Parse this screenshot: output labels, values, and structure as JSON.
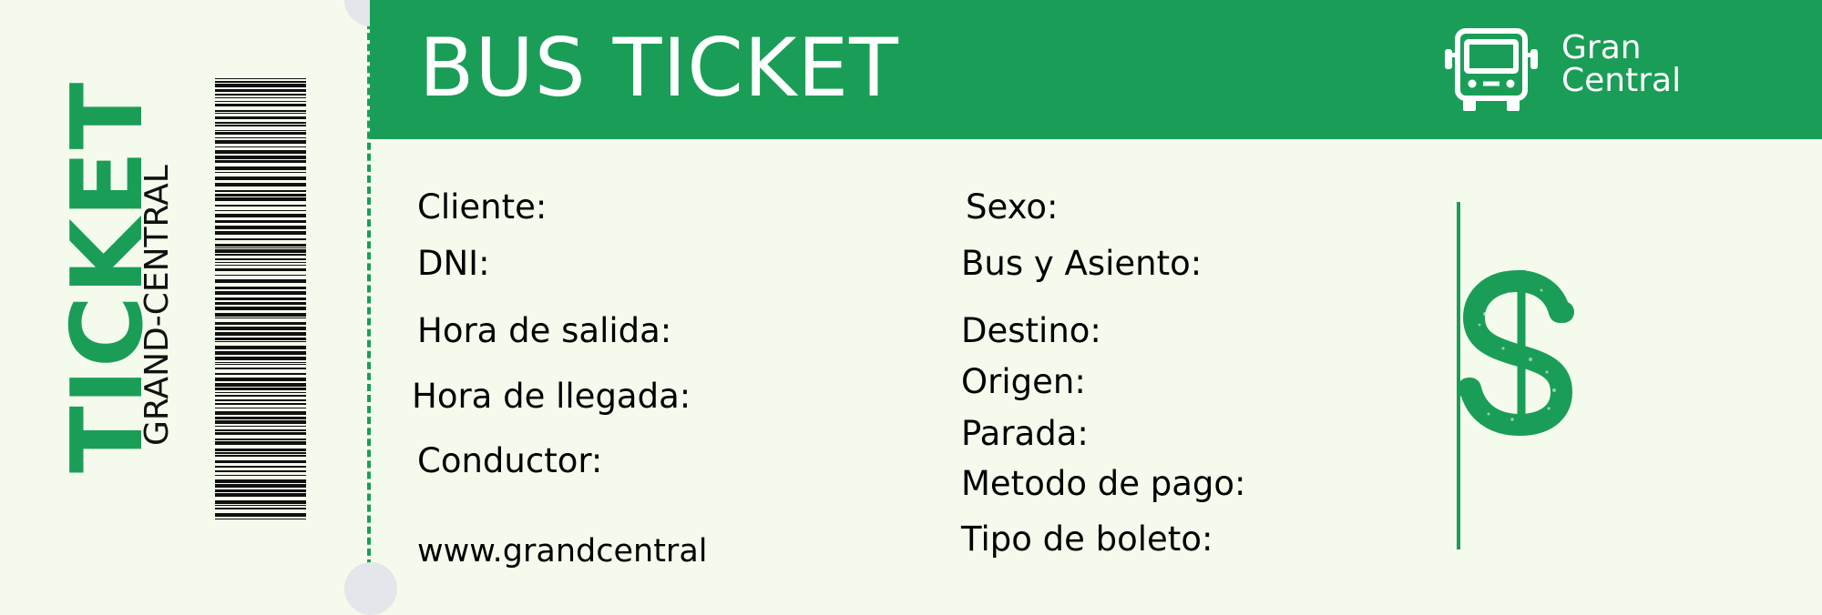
{
  "stub": {
    "title": "TICKET",
    "subtitle": "GRAND-CENTRAL"
  },
  "header": {
    "title": "BUS TICKET",
    "brand_line1": "Gran",
    "brand_line2": "Central"
  },
  "fields_left": {
    "cliente": "Cliente:",
    "dni": "DNI:",
    "hora_salida": "Hora de salida:",
    "hora_llegada": "Hora de llegada:",
    "conductor": "Conductor:",
    "website": "www.grandcentral"
  },
  "fields_right": {
    "sexo": "Sexo:",
    "bus_asiento": "Bus y Asiento:",
    "destino": "Destino:",
    "origen": "Origen:",
    "parada": "Parada:",
    "metodo_pago": "Metodo de pago:",
    "tipo_boleto": "Tipo de boleto:"
  },
  "icons": {
    "bus": "bus-icon",
    "dollar": "dollar-sign-icon",
    "barcode": "barcode-icon"
  },
  "colors": {
    "accent_green": "#1a9e57",
    "background": "#f5fbec",
    "header_text": "#ffffff",
    "body_text": "#000000"
  }
}
